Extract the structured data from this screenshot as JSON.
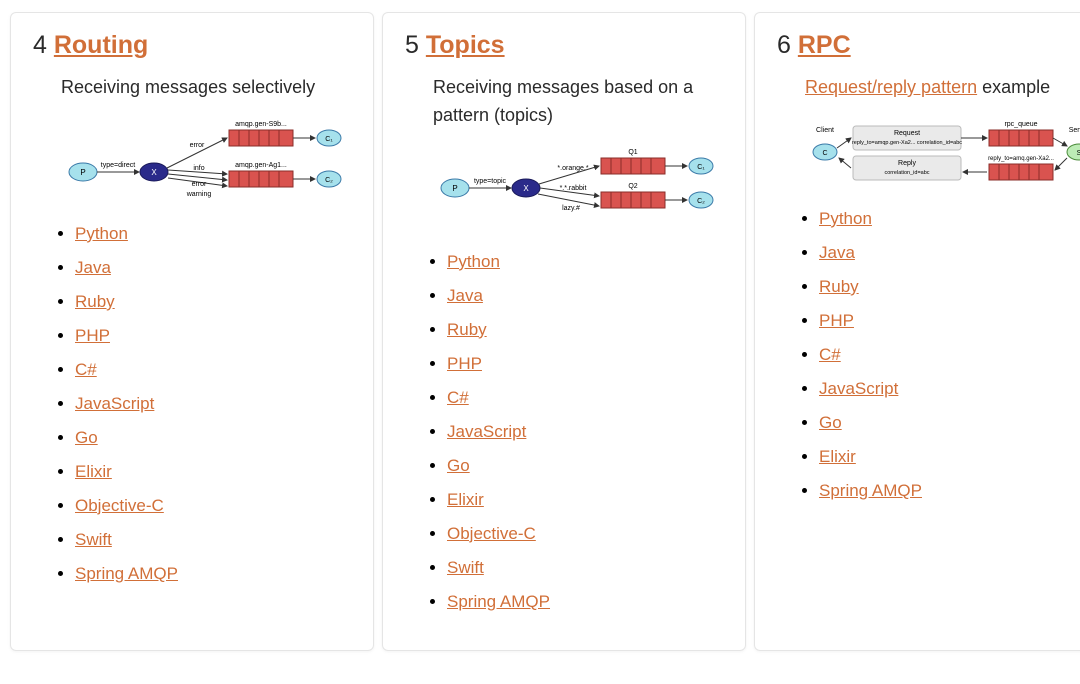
{
  "cards": [
    {
      "number": "4",
      "title": "Routing",
      "description": "Receiving messages selectively",
      "link_label": "",
      "link_tail": "",
      "diagram": "routing",
      "links": [
        "Python",
        "Java",
        "Ruby",
        "PHP",
        "C#",
        "JavaScript",
        "Go",
        "Elixir",
        "Objective-C",
        "Swift",
        "Spring AMQP"
      ]
    },
    {
      "number": "5",
      "title": "Topics",
      "description": "Receiving messages based on a pattern (topics)",
      "link_label": "",
      "link_tail": "",
      "diagram": "topics",
      "links": [
        "Python",
        "Java",
        "Ruby",
        "PHP",
        "C#",
        "JavaScript",
        "Go",
        "Elixir",
        "Objective-C",
        "Swift",
        "Spring AMQP"
      ]
    },
    {
      "number": "6",
      "title": "RPC",
      "description": "",
      "link_label": "Request/reply pattern",
      "link_tail": " example",
      "diagram": "rpc",
      "links": [
        "Python",
        "Java",
        "Ruby",
        "PHP",
        "C#",
        "JavaScript",
        "Go",
        "Elixir",
        "Spring AMQP"
      ]
    }
  ],
  "diagrams": {
    "routing": {
      "producer": "P",
      "type_label": "type=direct",
      "queues": [
        {
          "name": "amqp.gen-S9b...",
          "bindings": [
            "error"
          ]
        },
        {
          "name": "amqp.gen-Ag1...",
          "bindings": [
            "info",
            "error",
            "warning"
          ]
        }
      ],
      "consumers": [
        "C₁",
        "C₂"
      ]
    },
    "topics": {
      "producer": "P",
      "type_label": "type=topic",
      "queues": [
        {
          "name": "Q1",
          "bindings": [
            "*.orange.*"
          ]
        },
        {
          "name": "Q2",
          "bindings": [
            "*.*.rabbit",
            "lazy.#"
          ]
        }
      ],
      "consumers": [
        "C₁",
        "C₂"
      ]
    },
    "rpc": {
      "client_label": "Client",
      "server_label": "Server",
      "client_node": "C",
      "server_node": "S",
      "request_name": "Request",
      "request_sub": "reply_to=amqp.gen-Xa2... correlation_id=abc",
      "reply_name": "Reply",
      "reply_sub": "correlation_id=abc",
      "queue1": "rpc_queue",
      "queue2": "reply_to=amq.gen-Xa2..."
    }
  }
}
